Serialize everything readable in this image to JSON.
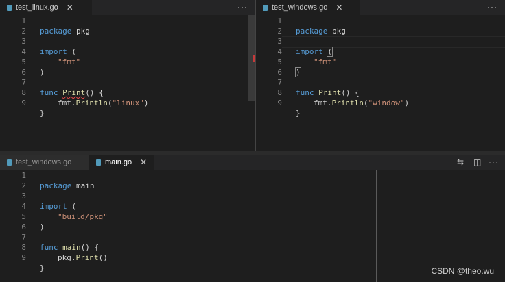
{
  "top_left": {
    "tab": {
      "name": "test_linux.go",
      "close": "✕"
    },
    "more": "···",
    "lines": [
      {
        "n": "1"
      },
      {
        "n": "2"
      },
      {
        "n": "3"
      },
      {
        "n": "4"
      },
      {
        "n": "5"
      },
      {
        "n": "6"
      },
      {
        "n": "7"
      },
      {
        "n": "8"
      },
      {
        "n": "9"
      }
    ],
    "code": {
      "l1_kw": "package",
      "l1_id": "pkg",
      "l3_kw": "import",
      "l3_p": "(",
      "l4_str": "\"fmt\"",
      "l5_p": ")",
      "l7_kw": "func",
      "l7_fn": "Print",
      "l7_p": "() {",
      "l8_id": "fmt",
      "l8_dot": ".",
      "l8_fn": "Println",
      "l8_p1": "(",
      "l8_str": "\"linux\"",
      "l8_p2": ")",
      "l9_p": "}"
    }
  },
  "top_right": {
    "tab": {
      "name": "test_windows.go",
      "close": "✕"
    },
    "more": "···",
    "lines": [
      {
        "n": "1"
      },
      {
        "n": "2"
      },
      {
        "n": "3"
      },
      {
        "n": "4"
      },
      {
        "n": "5"
      },
      {
        "n": "6"
      },
      {
        "n": "7"
      },
      {
        "n": "8"
      },
      {
        "n": "9"
      }
    ],
    "code": {
      "l1_kw": "package",
      "l1_id": "pkg",
      "l3_kw": "import",
      "l3_p": "(",
      "l4_str": "\"fmt\"",
      "l5_p": ")",
      "l7_kw": "func",
      "l7_fn": "Print",
      "l7_p": "() {",
      "l8_id": "fmt",
      "l8_dot": ".",
      "l8_fn": "Println",
      "l8_p1": "(",
      "l8_str": "\"window\"",
      "l8_p2": ")",
      "l9_p": "}"
    }
  },
  "bottom": {
    "tabs": [
      {
        "name": "test_windows.go"
      },
      {
        "name": "main.go",
        "close": "✕"
      }
    ],
    "compare_icon": "⇆",
    "split_icon": "◫",
    "more": "···",
    "lines": [
      {
        "n": "1"
      },
      {
        "n": "2"
      },
      {
        "n": "3"
      },
      {
        "n": "4"
      },
      {
        "n": "5"
      },
      {
        "n": "6"
      },
      {
        "n": "7"
      },
      {
        "n": "8"
      },
      {
        "n": "9"
      }
    ],
    "code": {
      "l1_kw": "package",
      "l1_id": "main",
      "l3_kw": "import",
      "l3_p": "(",
      "l4_str": "\"build/pkg\"",
      "l5_p": ")",
      "l7_kw": "func",
      "l7_fn": "main",
      "l7_p": "() {",
      "l8_id": "pkg",
      "l8_dot": ".",
      "l8_fn": "Print",
      "l8_p": "()",
      "l9_p": "}"
    }
  },
  "watermark": "CSDN @theo.wu",
  "colors": {
    "keyword": "#569cd6",
    "string": "#ce9178",
    "function": "#dcdcaa",
    "background": "#1e1e1e"
  }
}
